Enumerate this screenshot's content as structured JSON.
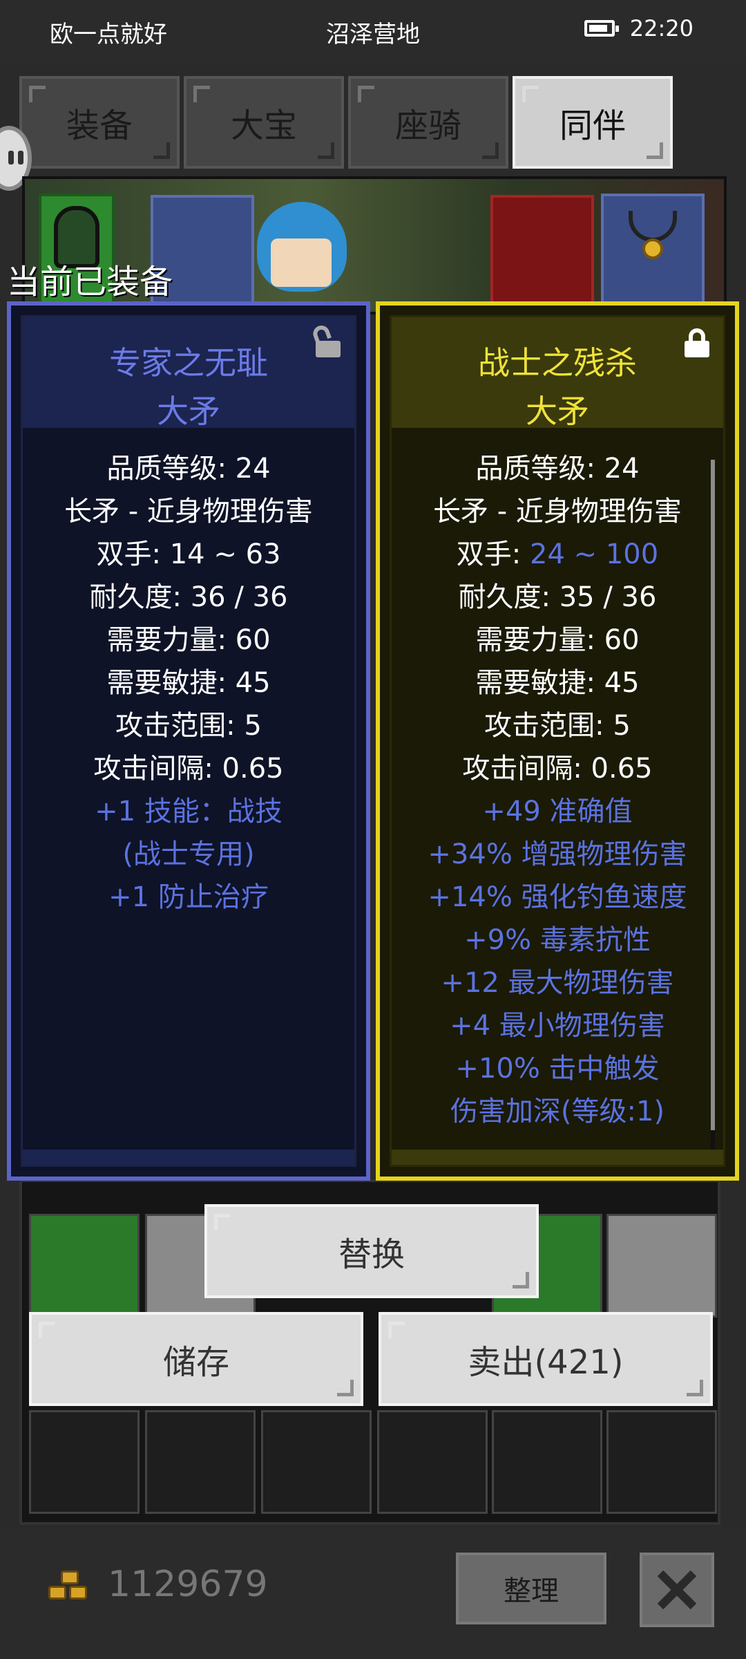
{
  "status": {
    "left": "欧一点就好",
    "center": "沼泽营地",
    "time": "22:20"
  },
  "tabs": [
    {
      "label": "装备",
      "active": false
    },
    {
      "label": "大宝",
      "active": false
    },
    {
      "label": "座骑",
      "active": false
    },
    {
      "label": "同伴",
      "active": true
    }
  ],
  "equipped_label": "当前已装备",
  "left_item": {
    "name": "专家之无耻",
    "type": "大矛",
    "lock": "unlocked",
    "stats_white": [
      "品质等级: 24",
      "长矛 - 近身物理伤害",
      "双手: 14 ~ 63",
      "耐久度: 36 / 36",
      "需要力量: 60",
      "需要敏捷: 45",
      "攻击范围: 5",
      "攻击间隔: 0.65"
    ],
    "stats_blue": [
      "+1 技能：战技",
      "(战士专用)",
      "+1 防止治疗"
    ]
  },
  "right_item": {
    "name": "战士之残杀",
    "type": "大矛",
    "lock": "locked",
    "quality": "品质等级: 24",
    "weapon_kind": "长矛 - 近身物理伤害",
    "two_hand_label": "双手: ",
    "two_hand_value": "24 ~ 100",
    "stats_white": [
      "耐久度: 35 / 36",
      "需要力量: 60",
      "需要敏捷: 45",
      "攻击范围: 5",
      "攻击间隔: 0.65"
    ],
    "stats_blue": [
      "+49 准确值",
      "+34% 增强物理伤害",
      "+14% 强化钓鱼速度",
      "+9% 毒素抗性",
      "+12 最大物理伤害",
      "+4 最小物理伤害",
      "+10% 击中触发",
      "伤害加深(等级:1)"
    ]
  },
  "buttons": {
    "replace": "替换",
    "store": "储存",
    "sell": "卖出(421)",
    "sort": "整理"
  },
  "gold": "1129679",
  "colors": {
    "blue_stat": "#5b72e0",
    "blue_border": "#5b64c8",
    "yellow_border": "#e5d41e",
    "yellow_text": "#f0e23a"
  }
}
